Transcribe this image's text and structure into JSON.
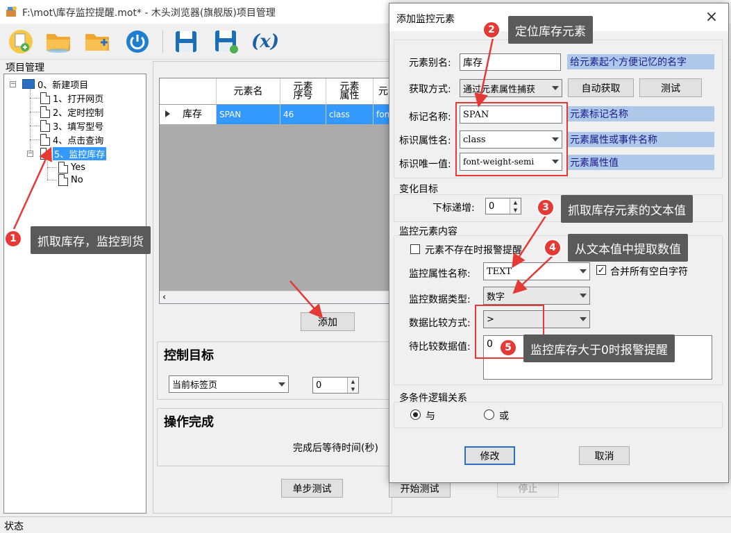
{
  "window": {
    "title": "F:\\mot\\库存监控提醒.mot* - 木头浏览器(旗舰版)项目管理"
  },
  "toolbar": {
    "icons": [
      "new-project-icon",
      "open-folder-icon",
      "add-folder-icon",
      "power-icon",
      "save-icon",
      "save-as-icon",
      "variable-icon"
    ],
    "variable_label": "(x)"
  },
  "project": {
    "label": "项目管理",
    "root": "0、新建项目",
    "nodes": [
      "1、打开网页",
      "2、定时控制",
      "3、填写型号",
      "4、点击查询",
      "5、监控库存"
    ],
    "children": [
      "Yes",
      "No"
    ]
  },
  "grid": {
    "headers": [
      "元素名",
      "元素\n序号",
      "元素\n属性",
      "元"
    ],
    "row": {
      "name": "库存",
      "element": "SPAN",
      "index": "46",
      "attr": "class",
      "value": "font"
    },
    "add_button": "添加"
  },
  "control": {
    "title": "控制目标",
    "target": "当前标签页",
    "value": "0"
  },
  "done": {
    "title": "操作完成",
    "wait_label": "完成后等待时间(秒)"
  },
  "bottom_buttons": {
    "step": "单步测试",
    "start": "开始测试",
    "stop": "停止"
  },
  "status": "状态",
  "dialog": {
    "title": "添加监控元素",
    "alias_label": "元素别名:",
    "alias_value": "库存",
    "alias_hint": "给元素起个方便记忆的名字",
    "method_label": "获取方式:",
    "method_value": "通过元素属性捕获",
    "auto_button": "自动获取",
    "test_button": "测试",
    "tag_label": "标记名称:",
    "tag_value": "SPAN",
    "tag_hint": "元素标记名称",
    "attr_label": "标识属性名:",
    "attr_value": "class",
    "attr_hint": "元素属性或事件名称",
    "unique_label": "标识唯一值:",
    "unique_value": "font-weight-semi",
    "unique_hint": "元素属性值",
    "change_group": "变化目标",
    "index_label": "下标递增:",
    "index_value": "0",
    "monitor_group": "监控元素内容",
    "not_exist_label": "元素不存在时报警提醒",
    "mon_attr_label": "监控属性名称:",
    "mon_attr_value": "TEXT",
    "merge_label": "合并所有空白字符",
    "data_type_label": "监控数据类型:",
    "data_type_value": "数字",
    "compare_label": "数据比较方式:",
    "compare_value": ">",
    "compare_value_label": "待比较数据值:",
    "compare_input": "0",
    "logic_group": "多条件逻辑关系",
    "and_label": "与",
    "or_label": "或",
    "modify_button": "修改",
    "cancel_button": "取消"
  },
  "annotations": [
    {
      "num": "1",
      "text": "抓取库存，监控到货"
    },
    {
      "num": "2",
      "text": "定位库存元素"
    },
    {
      "num": "3",
      "text": "抓取库存元素的文本值"
    },
    {
      "num": "4",
      "text": "从文本值中提取数值"
    },
    {
      "num": "5",
      "text": "监控库存大于0时报警提醒"
    }
  ],
  "colors": {
    "selection": "#3399ff",
    "hint": "#aec8ea",
    "annotation_red": "#e53935",
    "callout": "#5a5a5a"
  }
}
